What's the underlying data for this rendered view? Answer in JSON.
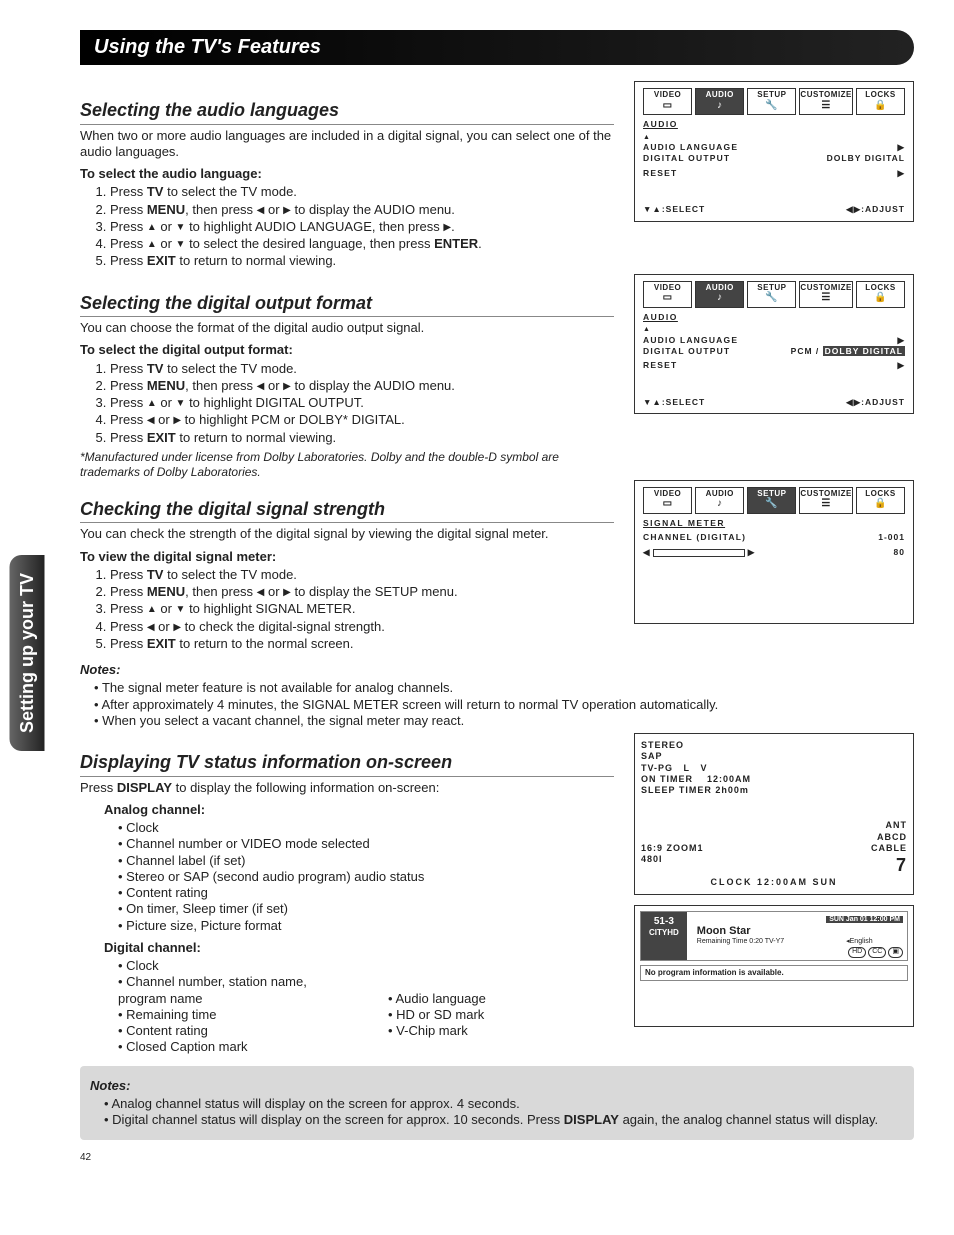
{
  "side_tab": "Setting up your TV",
  "banner": "Using the TV's Features",
  "page_number": "42",
  "sections": {
    "audio_lang": {
      "title": "Selecting the audio languages",
      "intro": "When two or more audio languages are included in a digital signal, you can select one of the audio languages.",
      "sub": "To select the audio language:",
      "steps": [
        "Press TV to select the TV mode.",
        "Press MENU, then press ◀ or ▶ to display the AUDIO menu.",
        "Press ▲ or ▼ to highlight AUDIO LANGUAGE, then press ▶.",
        "Press ▲ or ▼ to select the desired language, then press ENTER.",
        "Press EXIT to return to normal viewing."
      ]
    },
    "digital_out": {
      "title": "Selecting the digital output format",
      "intro": "You can choose the format of the digital audio output signal.",
      "sub": "To select the digital output format:",
      "steps": [
        "Press TV to select the TV mode.",
        "Press MENU, then press ◀ or ▶ to display the AUDIO menu.",
        "Press ▲ or ▼ to highlight DIGITAL OUTPUT.",
        "Press ◀ or ▶ to highlight PCM or DOLBY* DIGITAL.",
        "Press EXIT to return to normal viewing."
      ],
      "disclaimer": "*Manufactured under license from Dolby Laboratories. Dolby and the double-D symbol are trademarks of Dolby Laboratories."
    },
    "signal": {
      "title": "Checking the digital signal strength",
      "intro": "You can check the strength of the digital signal by viewing the digital signal meter.",
      "sub": "To view the digital signal meter:",
      "steps": [
        "Press TV to select the TV mode.",
        "Press  MENU, then press ◀ or ▶ to display the SETUP menu.",
        "Press ▲ or ▼ to highlight SIGNAL METER.",
        "Press ◀ or ▶ to check the digital-signal strength.",
        "Press EXIT to return to the normal screen."
      ],
      "notes_label": "Notes:",
      "notes": [
        "The signal meter feature is not available for analog channels.",
        "After approximately 4 minutes, the SIGNAL METER screen will return to normal TV operation automatically.",
        "When you select a vacant channel, the signal meter may react."
      ]
    },
    "display": {
      "title": "Displaying TV status information on-screen",
      "intro_prefix": "Press ",
      "intro_bold": "DISPLAY",
      "intro_suffix": " to display the following information on-screen:",
      "analog_label": "Analog channel:",
      "analog_items": [
        "Clock",
        "Channel number or VIDEO mode selected",
        "Channel label (if set)",
        "Stereo or SAP (second audio program) audio status",
        "Content rating",
        "On timer, Sleep timer (if set)",
        "Picture size, Picture format"
      ],
      "digital_label": "Digital channel:",
      "digital_left": [
        "Clock",
        "Channel number, station name, program name",
        "Remaining time",
        "Content rating",
        "Closed Caption mark"
      ],
      "digital_right": [
        "",
        "",
        "Audio language",
        "HD or SD mark",
        "V-Chip mark"
      ],
      "notes_label": "Notes:",
      "notes": [
        "Analog channel status will display on the screen for approx. 4 seconds.",
        "Digital channel status will display on the screen for approx. 10 seconds. Press DISPLAY again, the analog channel status will display."
      ]
    }
  },
  "osd": {
    "tabs": [
      "Video",
      "Audio",
      "Setup",
      "Customize",
      "Locks"
    ],
    "select": ":SELECT",
    "adjust": ":ADJUST",
    "audio1": {
      "title": "AUDIO",
      "r1": {
        "lbl": "AUDIO LANGUAGE",
        "val": "▶"
      },
      "r2": {
        "lbl": "DIGITAL OUTPUT",
        "val": "DOLBY DIGITAL"
      },
      "r3": {
        "lbl": "RESET",
        "val": "▶"
      }
    },
    "audio2": {
      "title": "AUDIO",
      "r1": {
        "lbl": "AUDIO LANGUAGE",
        "val": "▶"
      },
      "r2": {
        "lbl": "DIGITAL OUTPUT",
        "val_pre": "PCM /",
        "val_sel": "DOLBY DIGITAL"
      },
      "r3": {
        "lbl": "RESET",
        "val": "▶"
      }
    },
    "signal": {
      "title": "SIGNAL METER",
      "chan_lbl": "CHANNEL (DIGITAL)",
      "chan_val": "1-001",
      "strength": "80"
    }
  },
  "info_analog": {
    "l1": "STEREO",
    "l2": "SAP",
    "l3a": "TV-PG",
    "l3b": "L",
    "l3c": "V",
    "l4a": "ON TIMER",
    "l4b": "12:00AM",
    "l5": "SLEEP TIMER 2h00m",
    "ant": "ANT",
    "abcd": "ABCD",
    "cable": "CABLE",
    "zoom": "16:9 ZOOM1",
    "res": "480I",
    "clock": "CLOCK   12:00AM   SUN",
    "num": "7"
  },
  "info_digital": {
    "ch": "51-3",
    "call": "CITYHD",
    "prog": "Moon Star",
    "time_bar": "SUN Jan 01 12:00 PM",
    "remain": "Remaining Time  0:20  TV-Y7",
    "lang": "◂English",
    "caps": [
      "HD",
      "CC",
      "▣"
    ],
    "noprog": "No program information is available."
  }
}
